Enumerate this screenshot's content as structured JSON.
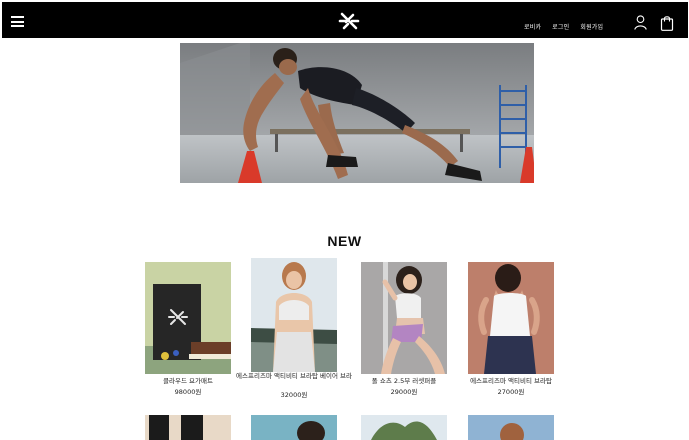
{
  "header": {
    "nav": [
      "로비카",
      "로그인",
      "회원가입"
    ],
    "icons": [
      "menu-icon",
      "logo-icon",
      "user-icon",
      "shopping-bag-icon"
    ]
  },
  "section": {
    "title": "NEW"
  },
  "products": [
    {
      "name": "클라우드 요가매트",
      "price": "98000원"
    },
    {
      "name": "에스프리즈마 액티비티 브라탑 베이어 브라",
      "price": "32000원"
    },
    {
      "name": "폴 쇼츠 2.5부 러셋퍼플",
      "price": "29000원"
    },
    {
      "name": "에스프리즈마 액티비티 브라탑",
      "price": "27000원"
    }
  ],
  "colors": {
    "header_bg": "#000000",
    "page_bg": "#ffffff",
    "text": "#111111"
  }
}
